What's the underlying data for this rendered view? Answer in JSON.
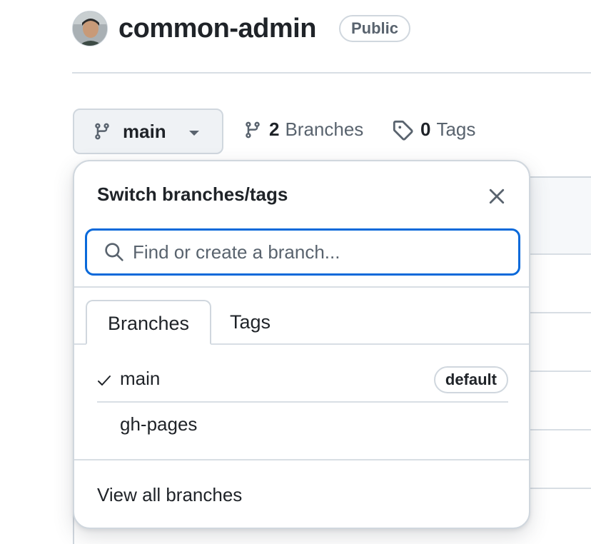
{
  "repo": {
    "name": "common-admin",
    "visibility": "Public"
  },
  "branch_bar": {
    "current_branch": "main",
    "branches_count": "2",
    "branches_label": "Branches",
    "tags_count": "0",
    "tags_label": "Tags"
  },
  "popover": {
    "title": "Switch branches/tags",
    "search_placeholder": "Find or create a branch...",
    "tabs": [
      {
        "label": "Branches",
        "active": true
      },
      {
        "label": "Tags",
        "active": false
      }
    ],
    "branches": [
      {
        "name": "main",
        "selected": true,
        "badge": "default"
      },
      {
        "name": "gh-pages",
        "selected": false
      }
    ],
    "footer_link": "View all branches"
  },
  "colors": {
    "accent": "#0969da",
    "text": "#1f2328",
    "muted": "#59636e",
    "border": "#d0d7de"
  },
  "icons": [
    "branch-icon",
    "chevron-down-icon",
    "tag-icon",
    "close-icon",
    "search-icon",
    "check-icon"
  ]
}
